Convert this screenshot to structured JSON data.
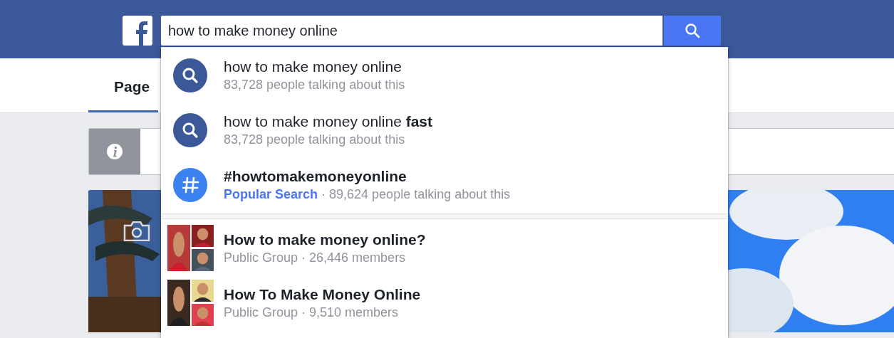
{
  "header": {
    "search": {
      "value": "how to make money online"
    }
  },
  "tabs": [
    {
      "label": "Page",
      "selected": true
    }
  ],
  "suggestions": [
    {
      "kind": "query",
      "title": "how to make money online",
      "subtitle": "83,728 people talking about this"
    },
    {
      "kind": "query",
      "title": "how to make money online **fast**",
      "subtitle": "83,728 people talking about this"
    },
    {
      "kind": "hashtag",
      "title": "#howtomakemoneyonline",
      "tag": "Popular Search",
      "subtitle": "· 89,624 people talking about this"
    },
    {
      "kind": "group",
      "title": "How to make money online?",
      "subtitle": "Public Group · 26,446 members"
    },
    {
      "kind": "group",
      "title": "How To Make Money Online",
      "subtitle": "Public Group · 9,510 members"
    }
  ]
}
